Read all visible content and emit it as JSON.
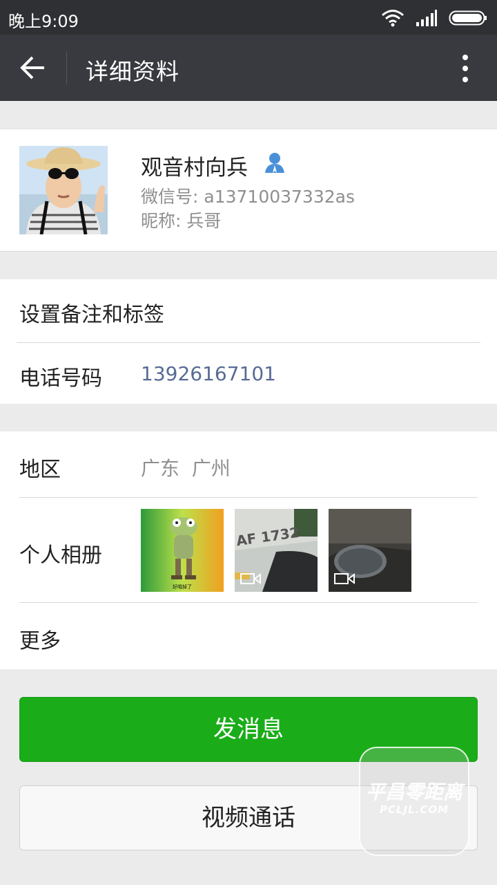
{
  "status_bar": {
    "time": "晚上9:09",
    "icons": [
      "wifi-icon",
      "signal-icon",
      "battery-icon"
    ]
  },
  "app_bar": {
    "title": "详细资料",
    "back_icon": "arrow-left-icon",
    "menu_icon": "more-vertical-icon"
  },
  "profile": {
    "name": "观音村向兵",
    "wechat_id": "微信号: a13710037332as",
    "nickname": "昵称: 兵哥",
    "badge_icon": "contact-person-icon"
  },
  "remark_row": {
    "label": "设置备注和标签"
  },
  "phone_row": {
    "label": "电话号码",
    "value": "13926167101",
    "value_color": "#576b95"
  },
  "region_row": {
    "label": "地区",
    "value": "广东  广州"
  },
  "album_row": {
    "label": "个人相册",
    "photos": [
      {
        "type": "image",
        "caption": "好哦掉了"
      },
      {
        "type": "video",
        "caption": "AF 1732"
      },
      {
        "type": "video",
        "caption": ""
      }
    ]
  },
  "more_row": {
    "label": "更多"
  },
  "buttons": {
    "send_message": "发消息",
    "video_call": "视频通话"
  },
  "watermark": {
    "line1": "平昌零距离",
    "line2": "PCLJL.COM"
  },
  "colors": {
    "primary_green": "#1aad19",
    "app_bar": "#393a3f",
    "status_bar": "#2f3033"
  }
}
